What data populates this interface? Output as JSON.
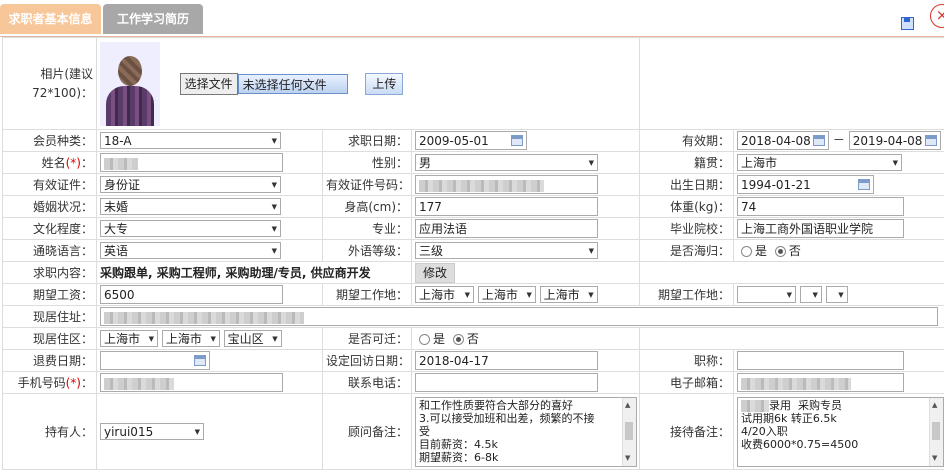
{
  "tabs": [
    {
      "label": "求职者基本信息"
    },
    {
      "label": "工作学习简历"
    }
  ],
  "close_glyph": "×",
  "photo": {
    "label": "相片(建议72*100)：",
    "file_button": "选择文件",
    "file_status": "未选择任何文件",
    "upload_button": "上传"
  },
  "member_type": {
    "label": "会员种类：",
    "value": "18-A"
  },
  "apply_date": {
    "label": "求职日期：",
    "value": "2009-05-01"
  },
  "valid_period": {
    "label": "有效期：",
    "start": "2018-04-08",
    "sep": "－",
    "end": "2019-04-08"
  },
  "name": {
    "label": "姓名",
    "req": "(*)",
    "colon": "："
  },
  "gender": {
    "label": "性别：",
    "value": "男"
  },
  "native": {
    "label": "籍贯：",
    "value": "上海市"
  },
  "id_type": {
    "label": "有效证件：",
    "value": "身份证"
  },
  "id_no": {
    "label": "有效证件号码："
  },
  "birth": {
    "label": "出生日期：",
    "value": "1994-01-21"
  },
  "marital": {
    "label": "婚姻状况：",
    "value": "未婚"
  },
  "height": {
    "label": "身高(cm)：",
    "value": "177"
  },
  "weight": {
    "label": "体重(kg)：",
    "value": "74"
  },
  "education": {
    "label": "文化程度：",
    "value": "大专"
  },
  "major": {
    "label": "专业：",
    "value": "应用法语"
  },
  "school": {
    "label": "毕业院校：",
    "value": "上海工商外国语职业学院"
  },
  "language": {
    "label": "通晓语言：",
    "value": "英语"
  },
  "lang_level": {
    "label": "外语等级：",
    "value": "三级"
  },
  "returnee": {
    "label": "是否海归：",
    "opt_yes": "是",
    "opt_no": "否"
  },
  "job_content": {
    "label": "求职内容：",
    "value": "采购跟单, 采购工程师, 采购助理/专员, 供应商开发",
    "modify": "修改"
  },
  "salary": {
    "label": "期望工资：",
    "value": "6500"
  },
  "work_place": {
    "label": "期望工作地：",
    "p1": "上海市",
    "p2": "上海市",
    "p3": "上海市"
  },
  "work_place2": {
    "label": "期望工作地："
  },
  "address": {
    "label": "现居住址："
  },
  "residence": {
    "label": "现居住区：",
    "p1": "上海市",
    "p2": "上海市",
    "p3": "宝山区"
  },
  "relocate": {
    "label": "是否可迁：",
    "opt_yes": "是",
    "opt_no": "否"
  },
  "exit_date": {
    "label": "退费日期："
  },
  "revisit": {
    "label": "设定回访日期：",
    "value": "2018-04-17"
  },
  "title": {
    "label": "职称："
  },
  "mobile": {
    "label": "手机号码",
    "req": "(*)",
    "colon": "："
  },
  "phone": {
    "label": "联系电话："
  },
  "email": {
    "label": "电子邮箱："
  },
  "holder": {
    "label": "持有人：",
    "value": "yirui015"
  },
  "consultant_note": {
    "label": "顾问备注：",
    "text": "和工作性质要符合大部分的喜好\n3.可以接受加班和出差，频繁的不接\n受\n目前薪资：4.5k\n期望薪资：6-8k"
  },
  "reception_note": {
    "label": "接待备注：",
    "line1": "录用  采购专员",
    "rest": "试用期6k 转正6.5k\n4/20入职\n收费6000*0.75=4500"
  }
}
